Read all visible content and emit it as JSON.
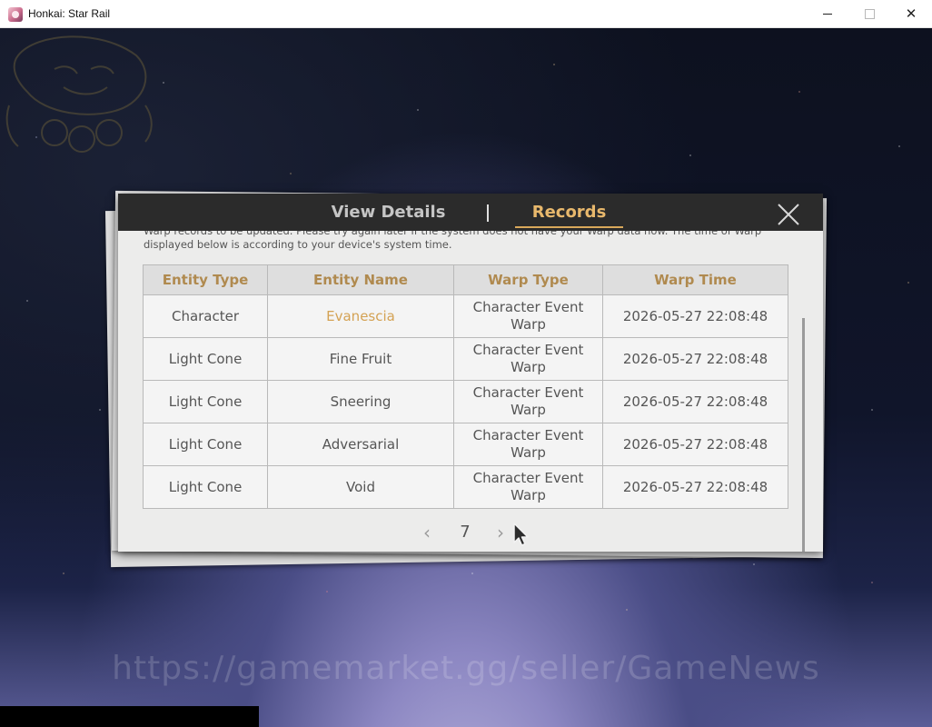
{
  "window": {
    "title": "Honkai: Star Rail",
    "controls": {
      "minimize": "minimize-icon",
      "maximize": "maximize-icon",
      "close": "✕"
    }
  },
  "dialog": {
    "tabs": [
      {
        "label": "View Details",
        "active": false
      },
      {
        "label": "Records",
        "active": true
      }
    ],
    "close_icon": "close-icon",
    "notice": "Warp records to be updated. Please try again later if the system does not have your Warp data now. The time of Warp displayed below is according to your device's system time.",
    "table": {
      "headers": [
        "Entity Type",
        "Entity Name",
        "Warp Type",
        "Warp Time"
      ],
      "rows": [
        {
          "entity_type": "Character",
          "entity_name": "Evanescia",
          "warp_type_line1": "Character Event",
          "warp_type_line2": "Warp",
          "warp_time": "2026-05-27 22:08:48",
          "highlight": true
        },
        {
          "entity_type": "Light Cone",
          "entity_name": "Fine Fruit",
          "warp_type_line1": "Character Event",
          "warp_type_line2": "Warp",
          "warp_time": "2026-05-27 22:08:48",
          "highlight": false
        },
        {
          "entity_type": "Light Cone",
          "entity_name": "Sneering",
          "warp_type_line1": "Character Event",
          "warp_type_line2": "Warp",
          "warp_time": "2026-05-27 22:08:48",
          "highlight": false
        },
        {
          "entity_type": "Light Cone",
          "entity_name": "Adversarial",
          "warp_type_line1": "Character Event",
          "warp_type_line2": "Warp",
          "warp_time": "2026-05-27 22:08:48",
          "highlight": false
        },
        {
          "entity_type": "Light Cone",
          "entity_name": "Void",
          "warp_type_line1": "Character Event",
          "warp_type_line2": "Warp",
          "warp_time": "2026-05-27 22:08:48",
          "highlight": false
        }
      ]
    },
    "pager": {
      "prev": "‹",
      "page": "7",
      "next": "›"
    }
  },
  "colors": {
    "accent_gold": "#d4a254",
    "header_gold": "#b08a4f",
    "tab_active": "#e8b86c",
    "dialog_bg": "#ececeb",
    "header_bg": "#2b2b2b"
  },
  "watermark": "https://gamemarket.gg/seller/GameNews"
}
